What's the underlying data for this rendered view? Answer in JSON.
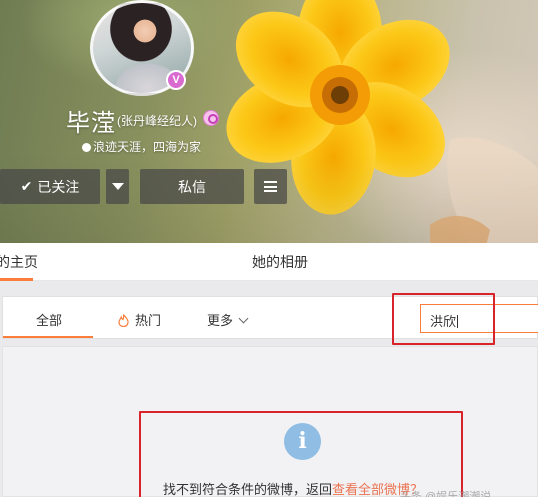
{
  "profile": {
    "name": "毕滢",
    "sub_name": "(张丹峰经纪人)",
    "verified_badge": "V",
    "motto": "浪迹天涯，四海为家"
  },
  "actions": {
    "follow_label": "已关注",
    "message_label": "私信"
  },
  "tabs": {
    "home_label": "的主页",
    "album_label": "她的相册"
  },
  "filter": {
    "all_label": "全部",
    "hot_label": "热门",
    "more_label": "更多",
    "search_value": "洪欣"
  },
  "empty_state": {
    "message_prefix": "找不到符合条件的微博，返回",
    "link_label": "查看全部微博？"
  },
  "watermark": "头条 @娱乐潮潮说"
}
